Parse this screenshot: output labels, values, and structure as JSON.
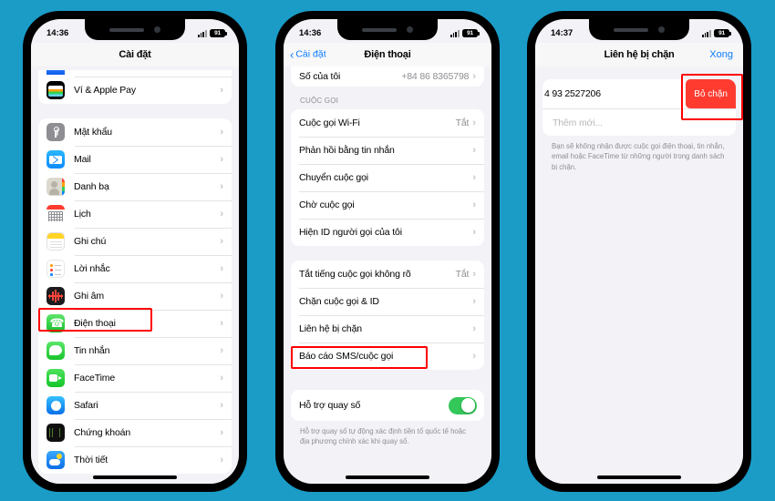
{
  "background_color": "#1a9cc7",
  "accent_blue": "#0a7cff",
  "highlight_color": "#ff0000",
  "toggle_on_color": "#34c759",
  "destructive_color": "#ff3b30",
  "phones": [
    {
      "id": "phone-settings-list",
      "status": {
        "time": "14:36",
        "battery": "91"
      },
      "nav": {
        "title": "Cài đặt",
        "back": null,
        "right": null
      },
      "groups": [
        {
          "rows": [
            {
              "label": "",
              "icon": "cut-off-icon",
              "partial": true
            },
            {
              "label": "Ví & Apple Pay",
              "icon": "wallet-icon",
              "chevron": "›"
            }
          ]
        },
        {
          "rows": [
            {
              "label": "Mật khẩu",
              "icon": "key-icon",
              "chevron": "›"
            },
            {
              "label": "Mail",
              "icon": "mail-icon",
              "chevron": "›"
            },
            {
              "label": "Danh bạ",
              "icon": "contacts-icon",
              "chevron": "›"
            },
            {
              "label": "Lịch",
              "icon": "calendar-icon",
              "chevron": "›"
            },
            {
              "label": "Ghi chú",
              "icon": "notes-icon",
              "chevron": "›"
            },
            {
              "label": "Lời nhắc",
              "icon": "reminders-icon",
              "chevron": "›"
            },
            {
              "label": "Ghi âm",
              "icon": "voice-memos-icon",
              "chevron": "›"
            },
            {
              "label": "Điện thoại",
              "icon": "phone-icon",
              "chevron": "›",
              "highlighted": true
            },
            {
              "label": "Tin nhắn",
              "icon": "messages-icon",
              "chevron": "›"
            },
            {
              "label": "FaceTime",
              "icon": "facetime-icon",
              "chevron": "›"
            },
            {
              "label": "Safari",
              "icon": "safari-icon",
              "chevron": "›"
            },
            {
              "label": "Chứng khoán",
              "icon": "stocks-icon",
              "chevron": "›"
            },
            {
              "label": "Thời tiết",
              "icon": "weather-icon",
              "chevron": "›"
            }
          ]
        }
      ]
    },
    {
      "id": "phone-telephone-settings",
      "status": {
        "time": "14:36",
        "battery": "91"
      },
      "nav": {
        "title": "Điện thoại",
        "back": "Cài đặt",
        "right": null
      },
      "my_number": {
        "label": "Số của tôi",
        "value": "+84 86 8365798",
        "chevron": "›"
      },
      "section_header": "CUỘC GỌI",
      "call_rows": [
        {
          "label": "Cuộc gọi Wi-Fi",
          "value": "Tắt",
          "chevron": "›"
        },
        {
          "label": "Phản hồi bằng tin nhắn",
          "value": "",
          "chevron": "›"
        },
        {
          "label": "Chuyển cuộc gọi",
          "value": "",
          "chevron": "›"
        },
        {
          "label": "Chờ cuộc gọi",
          "value": "",
          "chevron": "›"
        },
        {
          "label": "Hiện ID người gọi của tôi",
          "value": "",
          "chevron": "›"
        }
      ],
      "block_rows": [
        {
          "label": "Tắt tiếng cuộc gọi không rõ",
          "value": "Tắt",
          "chevron": "›"
        },
        {
          "label": "Chặn cuộc gọi & ID",
          "value": "",
          "chevron": "›"
        },
        {
          "label": "Liên hệ bị chặn",
          "value": "",
          "chevron": "›",
          "highlighted": true
        },
        {
          "label": "Báo cáo SMS/cuộc gọi",
          "value": "",
          "chevron": "›"
        }
      ],
      "dial_assist": {
        "label": "Hỗ trợ quay số",
        "toggle": "on"
      },
      "dial_footnote": "Hỗ trợ quay số tự động xác định tiền tố quốc tế hoặc địa phương chính xác khi quay số."
    },
    {
      "id": "phone-blocked-contacts",
      "status": {
        "time": "14:37",
        "battery": "91"
      },
      "nav": {
        "title": "Liên hệ bị chặn",
        "back": null,
        "right": "Xong"
      },
      "blocked": [
        {
          "number": "4 93 2527206",
          "action": "Bỏ chặn",
          "highlighted": true
        }
      ],
      "add_placeholder": "Thêm mới...",
      "footnote": "Bạn sẽ không nhận được cuộc gọi điện thoại, tin nhắn, email hoặc FaceTime từ những người trong danh sách bị chặn."
    }
  ]
}
